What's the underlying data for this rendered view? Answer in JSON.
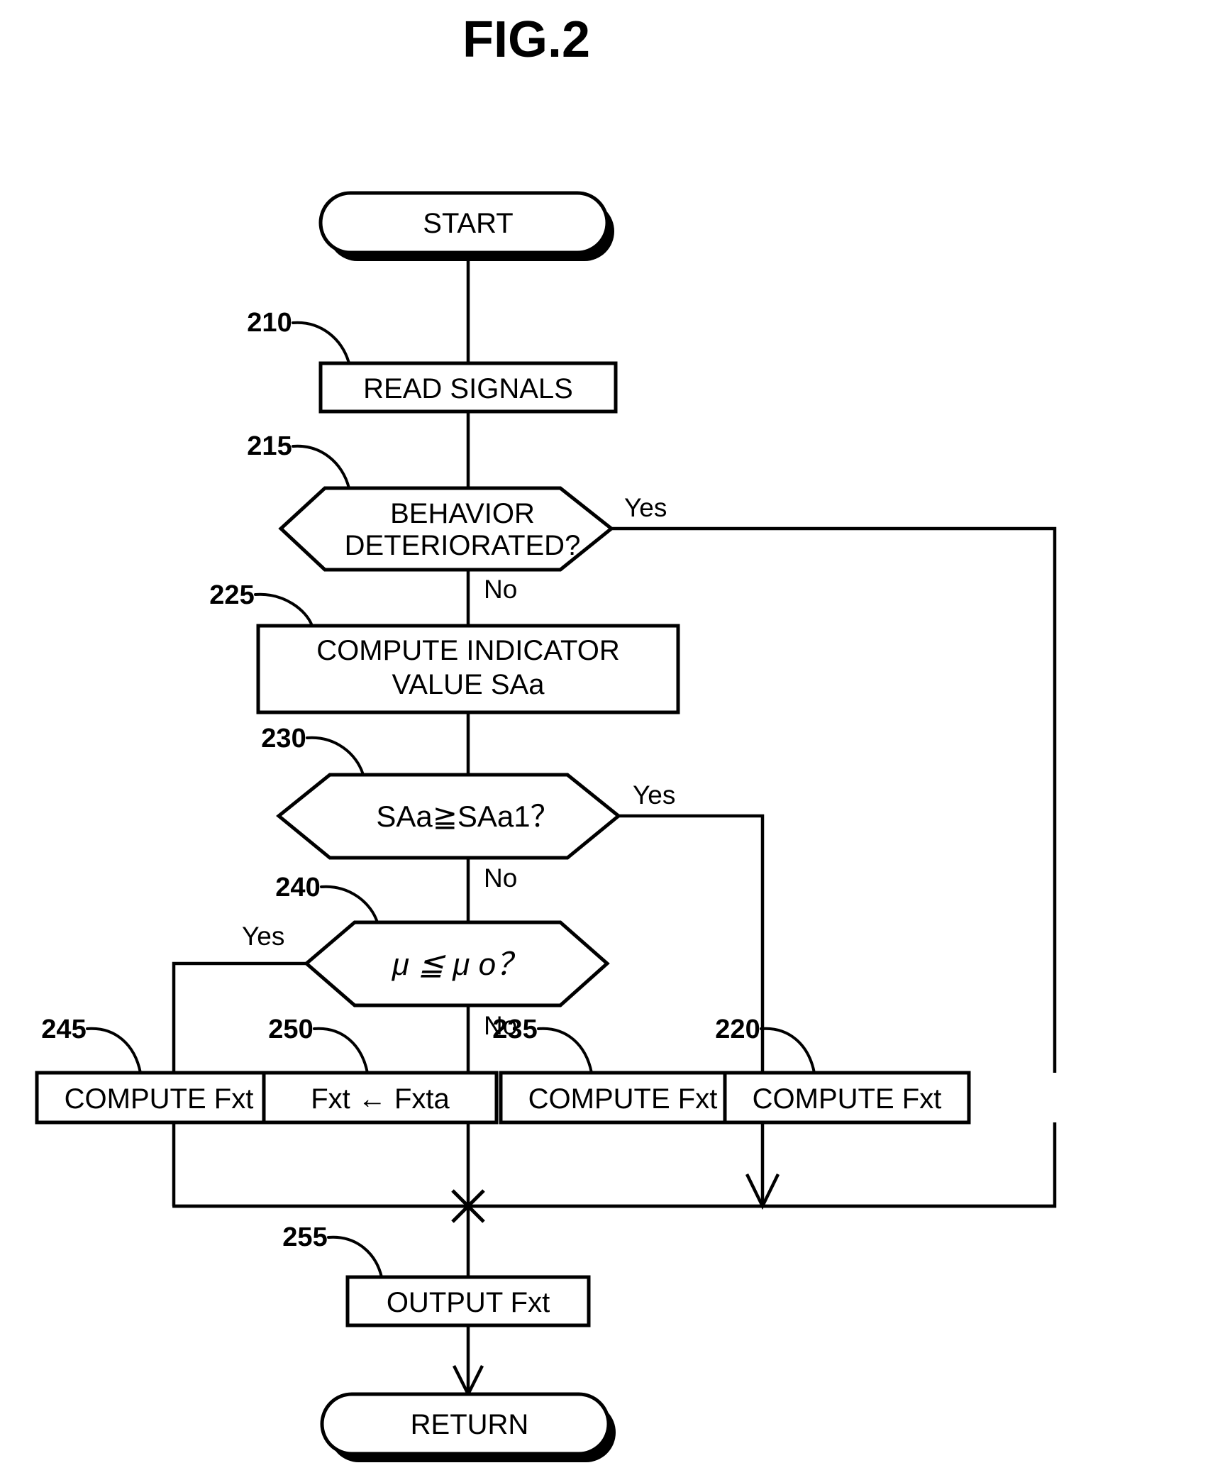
{
  "figure": {
    "title": "FIG.2",
    "type": "process-flowchart"
  },
  "nodes": {
    "start": {
      "label": "START",
      "shape": "terminator"
    },
    "read_signals": {
      "ref": "210",
      "label": "READ SIGNALS",
      "shape": "process"
    },
    "behavior": {
      "ref": "215",
      "line1": "BEHAVIOR",
      "line2": "DETERIORATED?",
      "shape": "decision"
    },
    "compute_indicator": {
      "ref": "225",
      "line1": "COMPUTE INDICATOR",
      "line2": "VALUE SAa",
      "shape": "process"
    },
    "saa_test": {
      "ref": "230",
      "label": "SAa≧SAa1？",
      "shape": "decision"
    },
    "mu_test": {
      "ref": "240",
      "label": "μ ≦ μ o？",
      "shape": "decision"
    },
    "compute_fxt_245": {
      "ref": "245",
      "label": "COMPUTE Fxt",
      "shape": "process"
    },
    "assign_fxta_250": {
      "ref": "250",
      "label": "Fxt ← Fxta",
      "shape": "process"
    },
    "compute_fxt_235": {
      "ref": "235",
      "label": "COMPUTE Fxt",
      "shape": "process"
    },
    "compute_fxt_220": {
      "ref": "220",
      "label": "COMPUTE Fxt",
      "shape": "process"
    },
    "output_fxt": {
      "ref": "255",
      "label": "OUTPUT Fxt",
      "shape": "process"
    },
    "return": {
      "label": "RETURN",
      "shape": "terminator"
    }
  },
  "edge_labels": {
    "behavior_yes": "Yes",
    "behavior_no": "No",
    "saa_yes": "Yes",
    "saa_no": "No",
    "mu_yes": "Yes",
    "mu_no": "No"
  },
  "colors": {
    "stroke": "#000000",
    "fill": "#ffffff",
    "background": "#ffffff"
  }
}
